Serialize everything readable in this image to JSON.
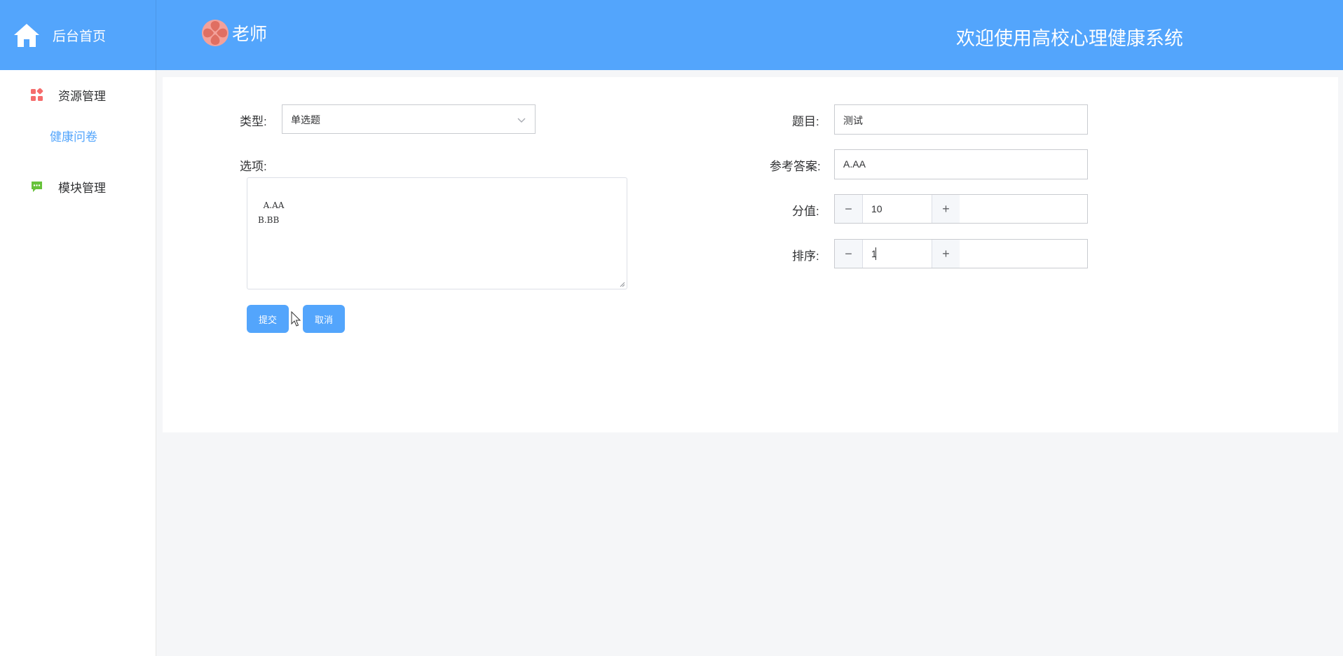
{
  "header": {
    "brand_label": "后台首页",
    "role": "老师",
    "welcome": "欢迎使用高校心理健康系统",
    "brand_color": "#53a5fc"
  },
  "sidebar": {
    "items": [
      {
        "label": "资源管理",
        "icon": "apps-grid-icon",
        "icon_color": "#f56c6c"
      },
      {
        "label": "健康问卷",
        "icon": "none",
        "active": true
      },
      {
        "label": "模块管理",
        "icon": "chat-bubble-icon",
        "icon_color": "#67c23a"
      }
    ]
  },
  "form": {
    "type_label": "类型:",
    "type_value": "单选题",
    "options_label": "选项:",
    "options_value": "A.AA\nB.BB",
    "title_label": "题目:",
    "title_value": "测试",
    "answer_label": "参考答案:",
    "answer_value": "A.AA",
    "score_label": "分值:",
    "score_value": "10",
    "order_label": "排序:",
    "order_value": "1",
    "submit_label": "提交",
    "cancel_label": "取消"
  }
}
